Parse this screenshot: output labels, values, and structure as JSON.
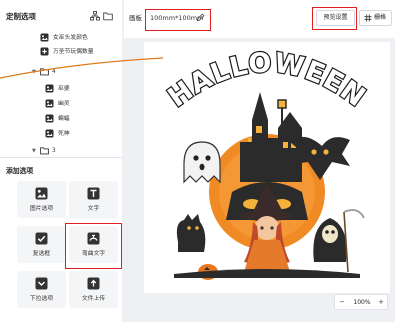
{
  "panel": {
    "title": "定制选项",
    "icons": [
      "hierarchy-icon",
      "folder-icon"
    ]
  },
  "tree": [
    {
      "type": "item",
      "label": "女巫头发颜色",
      "icon": "image-layer-icon"
    },
    {
      "type": "item",
      "label": "万圣节玩偶数量",
      "icon": "add-layer-icon"
    },
    {
      "type": "group",
      "label": "4",
      "expanded": true
    },
    {
      "type": "item",
      "label": "巫婆",
      "icon": "image-layer-icon"
    },
    {
      "type": "item",
      "label": "幽灵",
      "icon": "image-layer-icon"
    },
    {
      "type": "item",
      "label": "蝙蝠",
      "icon": "image-layer-icon"
    },
    {
      "type": "item",
      "label": "死神",
      "icon": "image-layer-icon"
    },
    {
      "type": "group",
      "label": "3",
      "expanded": true
    }
  ],
  "add_options": {
    "title": "添加选项",
    "items": [
      {
        "label": "图片选项",
        "icon": "image-option-icon"
      },
      {
        "label": "文字",
        "icon": "text-option-icon"
      },
      {
        "label": "复选框",
        "icon": "checkbox-icon"
      },
      {
        "label": "弯曲文字",
        "icon": "curved-text-icon"
      },
      {
        "label": "下拉选项",
        "icon": "dropdown-icon"
      },
      {
        "label": "文件上传",
        "icon": "file-upload-icon"
      }
    ]
  },
  "topbar": {
    "artboard_label": "画板",
    "size": "100mm*100mm",
    "preview_label": "预览设置",
    "grid_label": "栅格"
  },
  "canvas": {
    "image_text": "HALLOWEEN"
  },
  "zoom": {
    "minus": "−",
    "value": "100%",
    "plus": "+"
  },
  "colors": {
    "accent": "#e02020",
    "orange": "#f08a24",
    "dark": "#2b2b2b"
  }
}
